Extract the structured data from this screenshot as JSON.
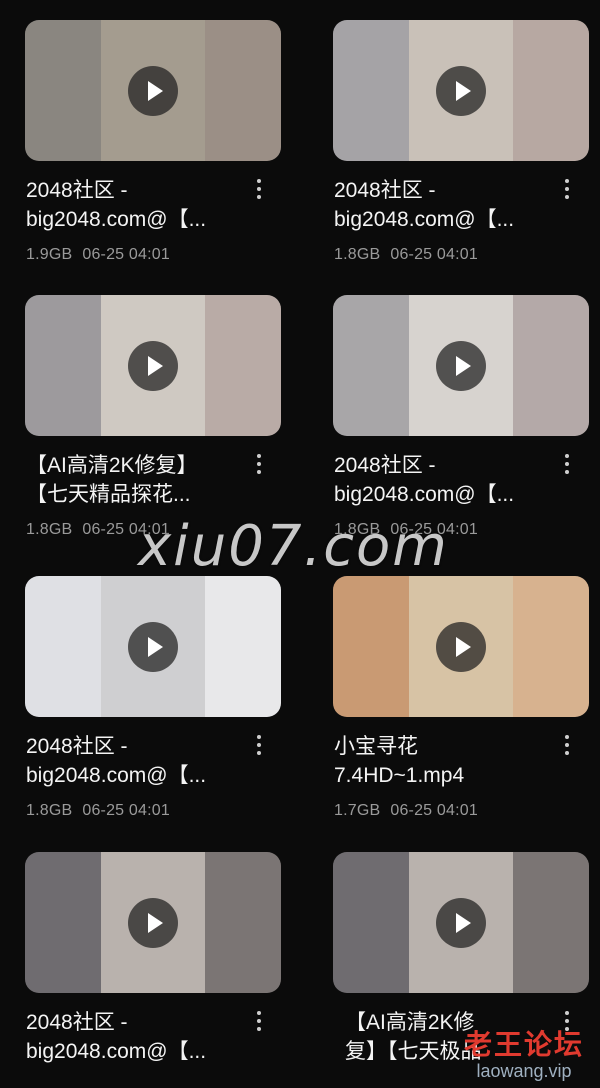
{
  "videos": [
    {
      "title_line1": "2048社区 -",
      "title_line2": "big2048.com@【...",
      "size": "1.9GB",
      "date": "06-25 04:01",
      "thumb": {
        "left": "#8a8680",
        "center": "#a49c8f",
        "right": "#9b8f86"
      }
    },
    {
      "title_line1": "2048社区 -",
      "title_line2": "big2048.com@【...",
      "size": "1.8GB",
      "date": "06-25 04:01",
      "thumb": {
        "left": "#a5a3a6",
        "center": "#c9c1b8",
        "right": "#b7a8a2"
      }
    },
    {
      "title_line1": "【AI高清2K修复】",
      "title_line2": "【七天精品探花...",
      "size": "1.8GB",
      "date": "06-25 04:01",
      "thumb": {
        "left": "#9d9a9d",
        "center": "#cfc9c2",
        "right": "#b9aba6"
      }
    },
    {
      "title_line1": "2048社区 -",
      "title_line2": "big2048.com@【...",
      "size": "1.8GB",
      "date": "06-25 04:01",
      "thumb": {
        "left": "#a8a6a8",
        "center": "#d7d3cf",
        "right": "#b4a9a8"
      }
    },
    {
      "title_line1": "2048社区 -",
      "title_line2": "big2048.com@【...",
      "size": "1.8GB",
      "date": "06-25 04:01",
      "thumb": {
        "left": "#dfe0e4",
        "center": "#cfcfd1",
        "right": "#e8e8ea"
      }
    },
    {
      "title_line1": "小宝寻花",
      "title_line2": "7.4HD~1.mp4",
      "size": "1.7GB",
      "date": "06-25 04:01",
      "thumb": {
        "left": "#c99a73",
        "center": "#d7c3a5",
        "right": "#d7b28f"
      }
    },
    {
      "title_line1": "2048社区 -",
      "title_line2": "big2048.com@【...",
      "size": "",
      "date": "",
      "thumb": {
        "left": "#6f6c70",
        "center": "#b9b2ad",
        "right": "#7b7574"
      }
    },
    {
      "title_line1": "【AI高清2K修",
      "title_line2": "复】【七天极品",
      "size": "",
      "date": "",
      "thumb": {
        "left": "#6f6c70",
        "center": "#b9b2ad",
        "right": "#7b7574"
      }
    }
  ],
  "watermark_text": "xiu07.com",
  "logo_watermark": {
    "cn": "老王论坛",
    "en": "laowang.vip"
  },
  "icons": {
    "play": "play-icon",
    "more": "more-vert-icon"
  }
}
